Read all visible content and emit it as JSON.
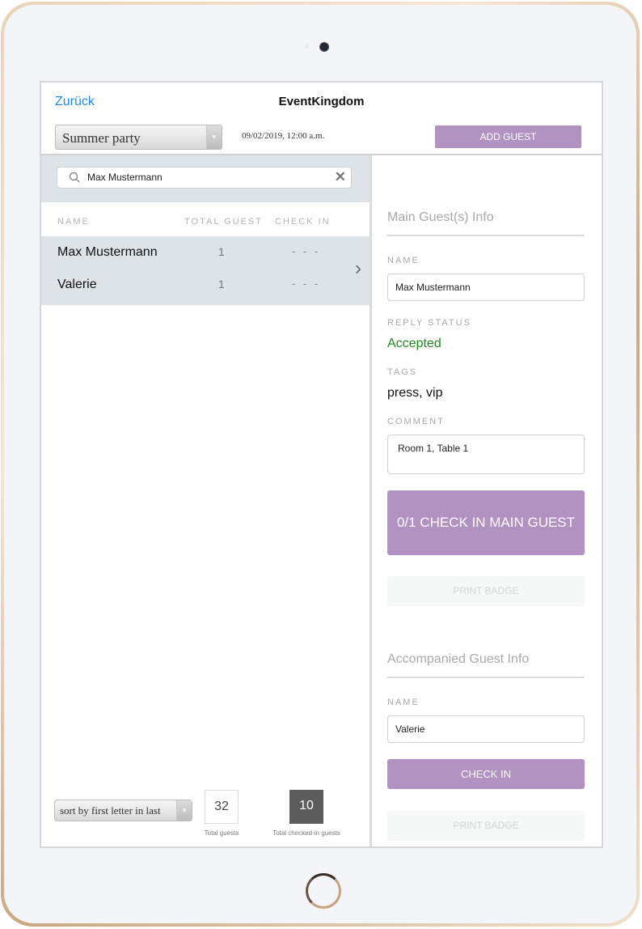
{
  "nav": {
    "back_label": "Zurück",
    "title": "EventKingdom"
  },
  "toolbar": {
    "event_selected": "Summer party",
    "event_datetime": "09/02/2019, 12:00 a.m.",
    "add_guest_label": "ADD GUEST"
  },
  "search": {
    "value": "Max Mustermann"
  },
  "guest_table": {
    "columns": [
      "NAME",
      "TOTAL GUEST",
      "CHECK IN"
    ],
    "rows": [
      {
        "name": "Max Mustermann",
        "total": "1",
        "check_in": "- - -"
      },
      {
        "name": "Valerie",
        "total": "1",
        "check_in": "- - -"
      }
    ]
  },
  "footer": {
    "sort_selected": "sort by first letter in last",
    "total_guests": "32",
    "total_guests_label": "Total guests",
    "checked_in": "10",
    "checked_in_label": "Total checked-in guests"
  },
  "main_guest": {
    "section_title": "Main Guest(s) Info",
    "name_label": "NAME",
    "name_value": "Max Mustermann",
    "reply_status_label": "REPLY STATUS",
    "reply_status_value": "Accepted",
    "tags_label": "TAGS",
    "tags_value": "press, vip",
    "comment_label": "COMMENT",
    "comment_value": "Room 1, Table 1",
    "checkin_button": "0/1 CHECK IN MAIN GUEST",
    "print_badge_button": "PRINT BADGE"
  },
  "accompanied_guest": {
    "section_title": "Accompanied Guest Info",
    "name_label": "NAME",
    "name_value": "Valerie",
    "checkin_button": "CHECK IN",
    "print_badge_button": "PRINT BADGE"
  },
  "colors": {
    "accent_purple": "#b292c1",
    "link_blue": "#1a8cf0",
    "status_green": "#1e8a1e"
  }
}
